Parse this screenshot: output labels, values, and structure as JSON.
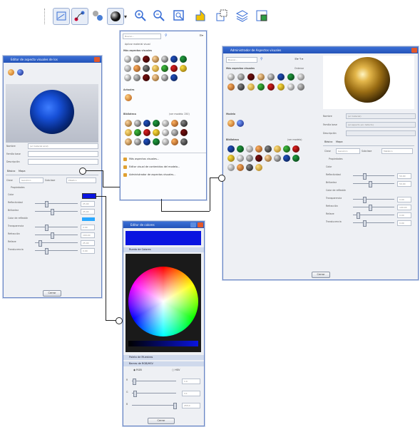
{
  "toolbar": {
    "icons": [
      "window-icon",
      "node-icon",
      "materials-icon",
      "material-sphere-icon",
      "dropdown-arrow-icon",
      "zoom-in-icon",
      "zoom-out-icon",
      "zoom-window-icon",
      "shift-icon",
      "copy-icon",
      "layers-icon",
      "export-icon"
    ]
  },
  "left_window": {
    "title": "Editor de aspecto visuales de los",
    "name_label": "Nombre",
    "name_value": "(el material azul)",
    "family_label": "Familia base",
    "desc_label": "Descripción",
    "tabs": [
      "Básico",
      "Mapa"
    ],
    "type_label": "Clase",
    "type_value": "Genérico",
    "subtype_label": "Subclase",
    "subtype_value": "Plástico",
    "props_header": "Propiedades",
    "rows": [
      "Color",
      "Reflectividad",
      "Brillantez",
      "Color de reflexión",
      "Transparencia",
      "Refracción",
      "Relieve",
      "Translucencia"
    ],
    "row_values": [
      "",
      "25.00",
      "25.00",
      "",
      "0.00",
      "100.00",
      "25.00",
      "0.00"
    ],
    "close_label": "Cerrar"
  },
  "dropdown": {
    "search_label": "Buscar...",
    "apply_label": "Aplicar material visual",
    "recent_header": "Más aspectos visuales",
    "current_label": "Actuales",
    "library_header": "Biblioteca",
    "library_filter": "(ver modelo: 250)",
    "menu_items": [
      "Más aspectos visuales...",
      "Editor visual de contenidos del modelo...",
      "Administrador de aspectos visuales..."
    ]
  },
  "right_window": {
    "title": "Administrador de Aspectos visuales",
    "search_label": "Buscar...",
    "recent_header": "Más aspectos visuales",
    "filter_label": "Ordenar",
    "current_header": "Modelo",
    "library_header": "Biblioteca",
    "library_filter": "(ver modelo)",
    "name_label": "Nombre",
    "name_value": "(el material)",
    "family_label": "Familia base",
    "family_value": "(el aspecto por defecto)",
    "desc_label": "Descripción",
    "tabs": [
      "Básico",
      "Mapa"
    ],
    "type_label": "Clase",
    "type_value": "Genérico",
    "subtype_label": "Subclase",
    "subtype_value": "Metálico",
    "props_header": "Propiedades",
    "rows": [
      "Color",
      "Reflectividad",
      "Brillantez",
      "Color de reflexión",
      "Transparencia",
      "Refracción",
      "Relieve",
      "Translucencia"
    ],
    "row_values": [
      "",
      "50.00",
      "50.00",
      "",
      "0.00",
      "100.00",
      "0.00",
      "0.00"
    ],
    "close_label": "Cerrar"
  },
  "color_window": {
    "title": "Editor de colores",
    "palette_header": "Rueda de Colores",
    "recent_header": "Paleta de Muestras",
    "mode_header": "Barras de RGB/HSV",
    "mode_rgb": "RGB",
    "mode_hsv": "HSV",
    "channels": [
      "R",
      "G",
      "B"
    ],
    "channel_values": [
      "1.0",
      "3.1",
      "255.0"
    ],
    "channel_levels": [
      0.02,
      0.03,
      1.0
    ],
    "close_label": "Cerrar",
    "selected_color": "#0a14e0"
  }
}
